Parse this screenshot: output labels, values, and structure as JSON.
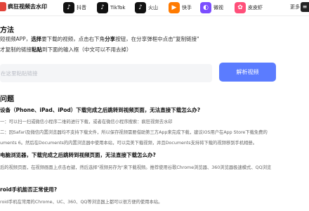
{
  "header": {
    "brand": "疯狂视频去水印",
    "colors": {
      "brand": "#e1443a",
      "accent": "#5b7cff"
    },
    "nav": [
      {
        "label": "抖音",
        "icon": "douyin-icon",
        "glyph": "♪",
        "color": "#111111"
      },
      {
        "label": "TikTok",
        "icon": "tiktok-icon",
        "glyph": "♪",
        "color": "#111111"
      },
      {
        "label": "火山",
        "icon": "huoshan-icon",
        "glyph": "♪",
        "color": "#111111"
      },
      {
        "label": "快手",
        "icon": "kuaishou-icon",
        "glyph": "▶",
        "color": "#ff7a00"
      },
      {
        "label": "微视",
        "icon": "weishi-icon",
        "glyph": "◐",
        "color": "#7b4dff"
      },
      {
        "label": "皮皮虾",
        "icon": "pipixia-icon",
        "glyph": "✿",
        "color": "#ff4f7a"
      }
    ],
    "more": "更多"
  },
  "method": {
    "title": "方法",
    "step1_pre": "短视频APP，",
    "step1_bold1": "选择",
    "step1_mid1": "要下载的视频，点击右下角",
    "step1_bold2": "分享",
    "step1_post": "按钮，在分享弹框中点击\"复制链接\"",
    "step2_pre": "才复制的链接",
    "step2_bold": "粘贴",
    "step2_post": "到下面的输入框（中文可以不用去掉）"
  },
  "input": {
    "placeholder": "在这里粘贴链接",
    "value": ""
  },
  "parse_button": "解析视频",
  "faq": {
    "title": "问题",
    "q1": "设备（Phone、iPad、iPod）下载完成之后跳转到视频页面，无法直接下载怎么办?",
    "q1_a1": "一：可以扫一扫或微信小程序二维码进行下载，或者在微信小程序搜索：疯狂视频去水印",
    "q1_a2": "二：因Safari及微信内置浏览器均不支持下载文件，所以保存视频需要借助第三方App来完成下载，建议iOS用户在App Store下载免费的",
    "q1_a3": "uments 6。然后在Documents的内置浏览器中使用本站，可以完美下载视频，并且Documents支持将下载的视频移到手机相册。",
    "q2": "电脑浏览器，下载完成之后跳转到视频页面，无法直接下载怎么办?",
    "q2_a1": "后的视频页面，在视频画面上点击右键，然后选择\"视频另存为\"来下载视频。推荐使用谷歌Chrome浏览器、360浏览器极速模式、QQ浏览",
    "q3": "roid手机能否正常使用?",
    "q3_a1": "roid手机在常用的Chrome、UC、360、QQ等浏览器上都可以很方便的使用本站。"
  }
}
